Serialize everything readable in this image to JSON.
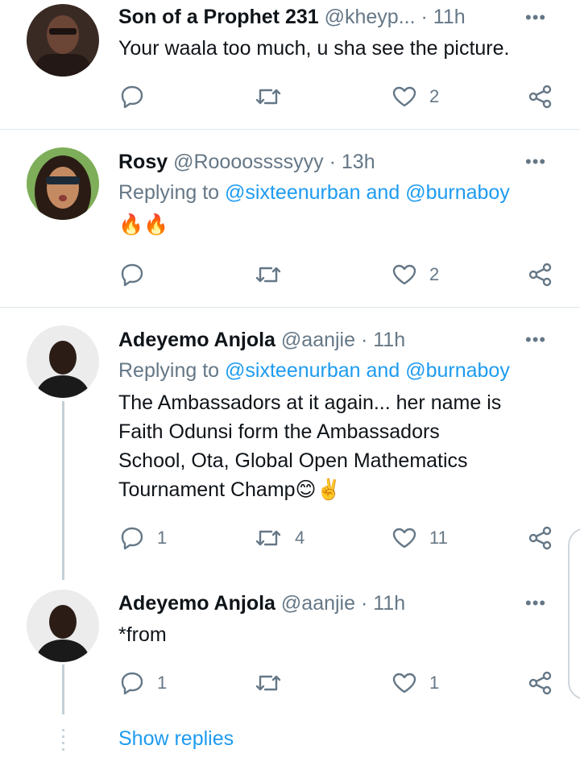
{
  "tweets": [
    {
      "name": "Son of a Prophet 231",
      "handle": "@kheyp...",
      "dot": "·",
      "time": "11h",
      "text": "Your waala too much, u sha see the picture.",
      "reply_count": "",
      "retweet_count": "",
      "like_count": "2"
    },
    {
      "name": "Rosy",
      "handle": "@Roooossssyyy",
      "dot": "·",
      "time": "13h",
      "replying_label": "Replying to",
      "mention1": "@sixteenurban",
      "and": "and",
      "mention2": "@burnaboy",
      "text": "🔥🔥",
      "reply_count": "",
      "retweet_count": "",
      "like_count": "2"
    },
    {
      "name": "Adeyemo Anjola",
      "handle": "@aanjie",
      "dot": "·",
      "time": "11h",
      "replying_label": "Replying to",
      "mention1": "@sixteenurban",
      "and": "and",
      "mention2": "@burnaboy",
      "text_line1": "The Ambassadors at it again... her name is",
      "text_line2": "Faith Odunsi form the Ambassadors",
      "text_line3": "School, Ota, Global Open Mathematics",
      "text_line4": "Tournament Champ😊✌️",
      "reply_count": "1",
      "retweet_count": "4",
      "like_count": "11"
    },
    {
      "name": "Adeyemo Anjola",
      "handle": "@aanjie",
      "dot": "·",
      "time": "11h",
      "text": "*from",
      "reply_count": "1",
      "retweet_count": "",
      "like_count": "1"
    }
  ],
  "show_replies": "Show replies",
  "colors": {
    "link": "#1d9bf0",
    "muted": "#657786",
    "divider": "#e1e8ed"
  }
}
